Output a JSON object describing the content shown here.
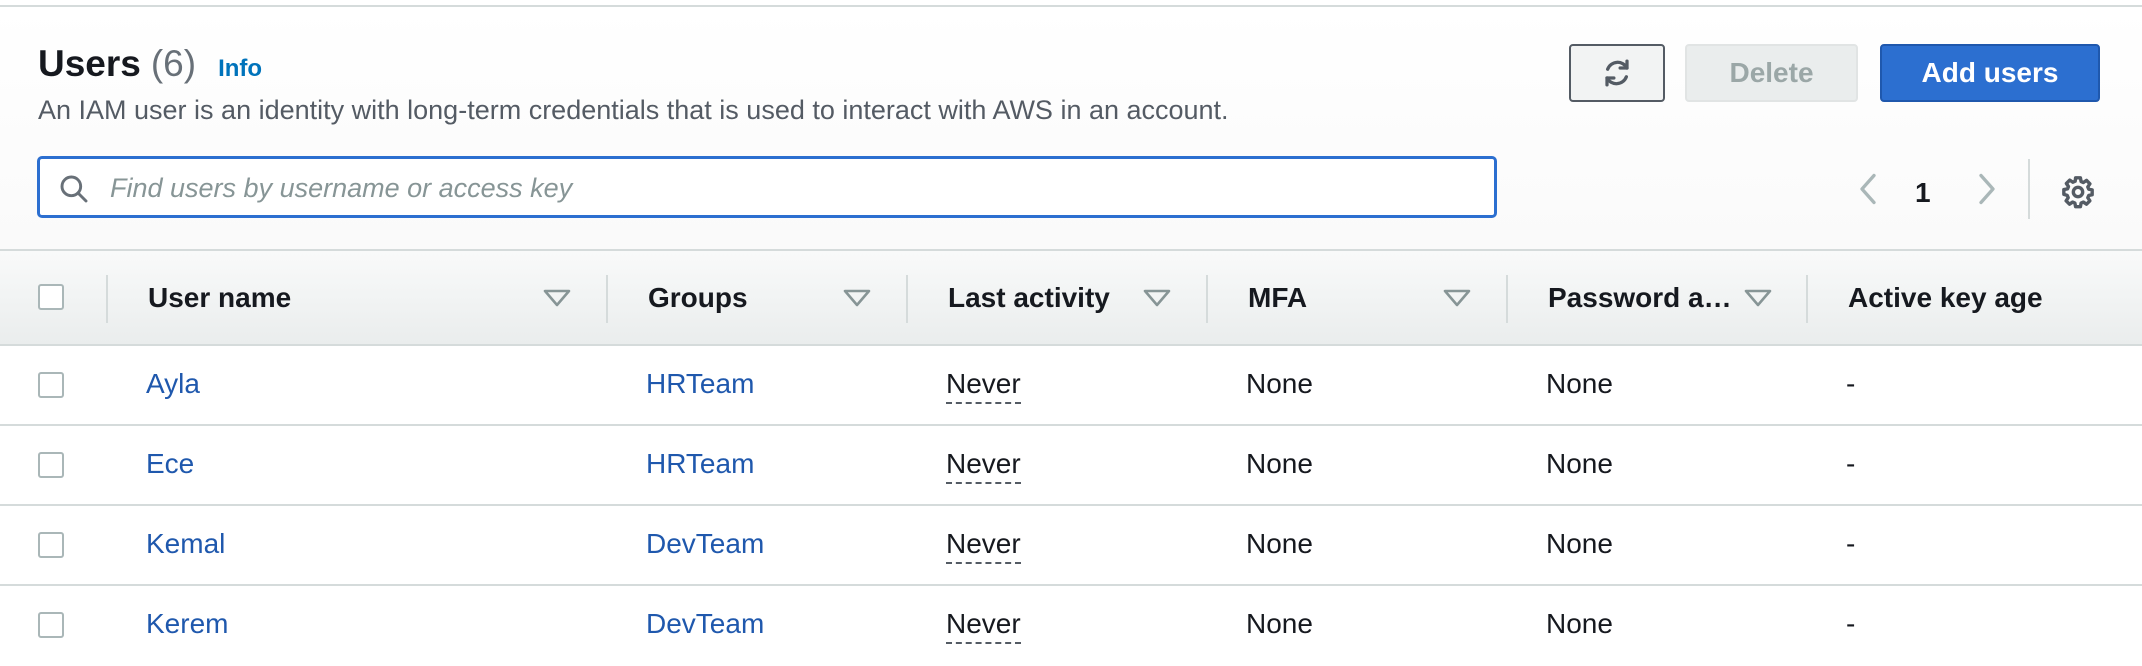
{
  "header": {
    "title": "Users",
    "count": "(6)",
    "info_link": "Info",
    "description": "An IAM user is an identity with long-term credentials that is used to interact with AWS in an account."
  },
  "toolbar": {
    "refresh_icon": "refresh-icon",
    "delete_label": "Delete",
    "add_users_label": "Add users"
  },
  "search": {
    "placeholder": "Find users by username or access key",
    "value": ""
  },
  "pagination": {
    "current_page": "1"
  },
  "table": {
    "columns": [
      "User name",
      "Groups",
      "Last activity",
      "MFA",
      "Password a…",
      "Active key age"
    ],
    "rows": [
      {
        "user": "Ayla",
        "group": "HRTeam",
        "last_activity": "Never",
        "mfa": "None",
        "password_age": "None",
        "key_age": "-"
      },
      {
        "user": "Ece",
        "group": "HRTeam",
        "last_activity": "Never",
        "mfa": "None",
        "password_age": "None",
        "key_age": "-"
      },
      {
        "user": "Kemal",
        "group": "DevTeam",
        "last_activity": "Never",
        "mfa": "None",
        "password_age": "None",
        "key_age": "-"
      },
      {
        "user": "Kerem",
        "group": "DevTeam",
        "last_activity": "Never",
        "mfa": "None",
        "password_age": "None",
        "key_age": "-"
      }
    ]
  },
  "colors": {
    "primary": "#2c6fd0",
    "link": "#1f58ad",
    "info": "#0073bb",
    "border": "#d5dbdb"
  }
}
